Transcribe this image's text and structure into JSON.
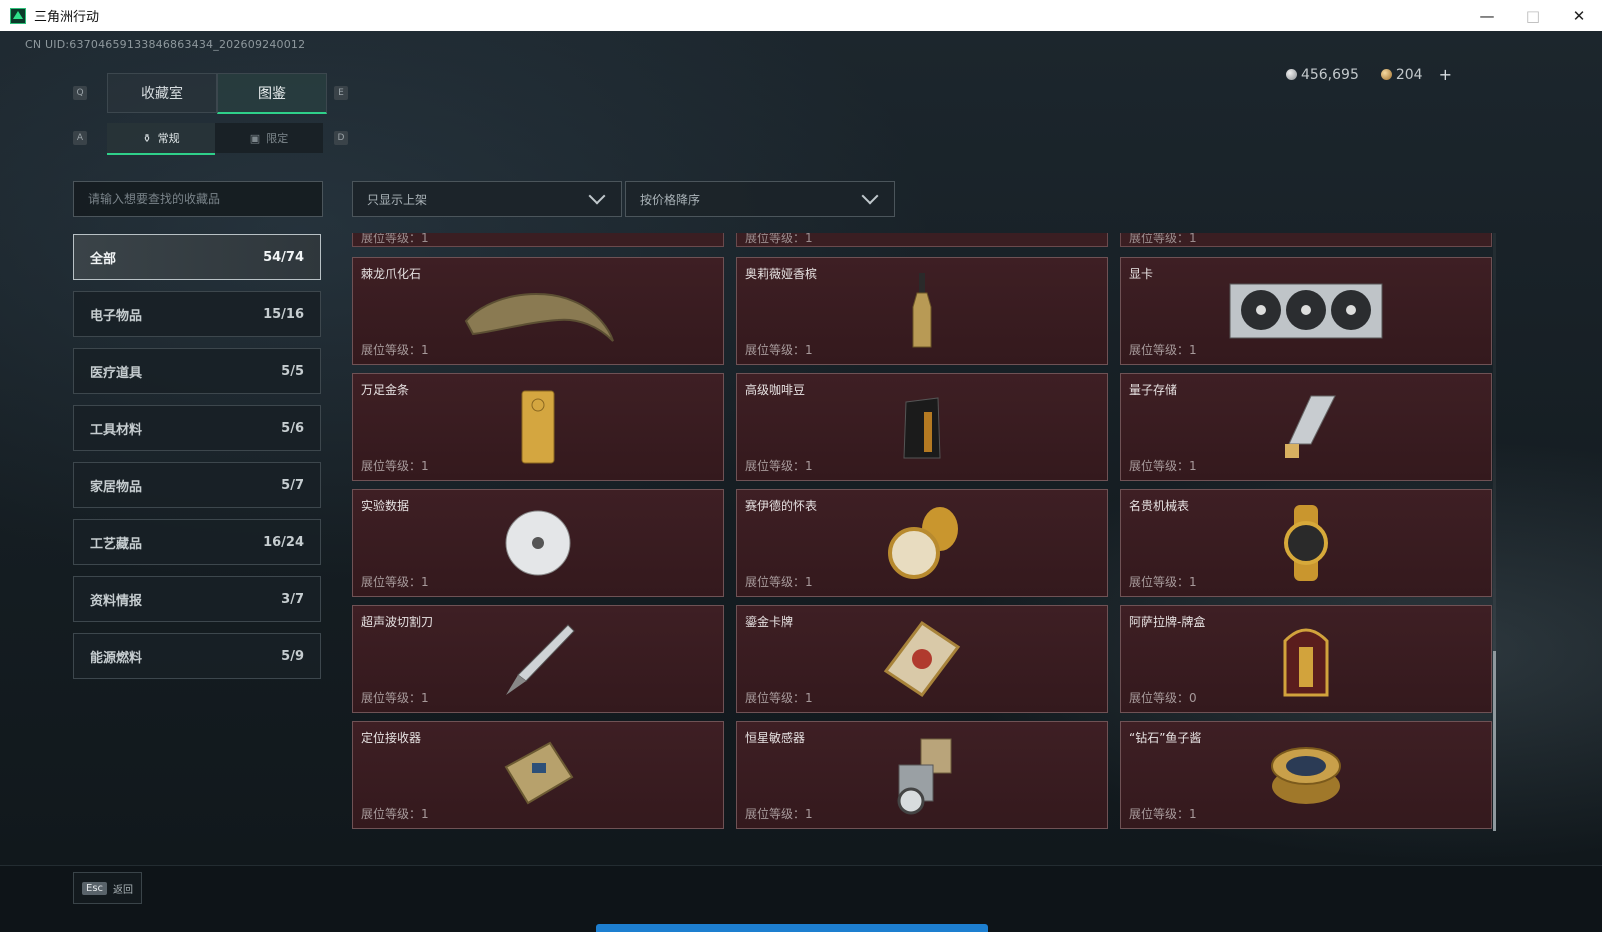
{
  "window": {
    "title": "三角洲行动",
    "minimize": "—",
    "maximize": "□",
    "close": "✕"
  },
  "uid": "CN UID:63704659133846863434_202609240012",
  "currency": {
    "silver": "456,695",
    "gold": "204",
    "add": "+"
  },
  "keys": {
    "q": "Q",
    "e": "E",
    "a": "A",
    "d": "D"
  },
  "top_tabs": [
    {
      "label": "收藏室",
      "active": false
    },
    {
      "label": "图鉴",
      "active": true
    }
  ],
  "sub_tabs": [
    {
      "label": "常规",
      "active": true
    },
    {
      "label": "限定",
      "active": false
    }
  ],
  "search": {
    "placeholder": "请输入想要查找的收藏品"
  },
  "filters": {
    "shelf": "只显示上架",
    "sort": "按价格降序"
  },
  "categories": [
    {
      "label": "全部",
      "count": "54/74"
    },
    {
      "label": "电子物品",
      "count": "15/16"
    },
    {
      "label": "医疗道具",
      "count": "5/5"
    },
    {
      "label": "工具材料",
      "count": "5/6"
    },
    {
      "label": "家居物品",
      "count": "5/7"
    },
    {
      "label": "工艺藏品",
      "count": "16/24"
    },
    {
      "label": "资料情报",
      "count": "3/7"
    },
    {
      "label": "能源燃料",
      "count": "5/9"
    }
  ],
  "level_label": "展位等级：",
  "partial_row": [
    "1",
    "1",
    "1"
  ],
  "items": [
    {
      "name": "棘龙爪化石",
      "level": "1",
      "icon": "claw-fossil-icon"
    },
    {
      "name": "奥莉薇娅香槟",
      "level": "1",
      "icon": "champagne-icon"
    },
    {
      "name": "显卡",
      "level": "1",
      "icon": "graphics-card-icon"
    },
    {
      "name": "万足金条",
      "level": "1",
      "icon": "gold-bar-icon"
    },
    {
      "name": "高级咖啡豆",
      "level": "1",
      "icon": "coffee-bag-icon"
    },
    {
      "name": "量子存储",
      "level": "1",
      "icon": "usb-drive-icon"
    },
    {
      "name": "实验数据",
      "level": "1",
      "icon": "disc-icon"
    },
    {
      "name": "赛伊德的怀表",
      "level": "1",
      "icon": "pocket-watch-icon"
    },
    {
      "name": "名贵机械表",
      "level": "1",
      "icon": "wristwatch-icon"
    },
    {
      "name": "超声波切割刀",
      "level": "1",
      "icon": "cutter-icon"
    },
    {
      "name": "鎏金卡牌",
      "level": "1",
      "icon": "gilded-card-icon"
    },
    {
      "name": "阿萨拉牌-牌盒",
      "level": "0",
      "icon": "card-box-icon"
    },
    {
      "name": "定位接收器",
      "level": "1",
      "icon": "receiver-icon"
    },
    {
      "name": "恒星敏感器",
      "level": "1",
      "icon": "star-sensor-icon"
    },
    {
      "name": "“钻石”鱼子酱",
      "level": "1",
      "icon": "caviar-tin-icon"
    }
  ],
  "footer": {
    "esc_key": "Esc",
    "back_label": "返回"
  }
}
